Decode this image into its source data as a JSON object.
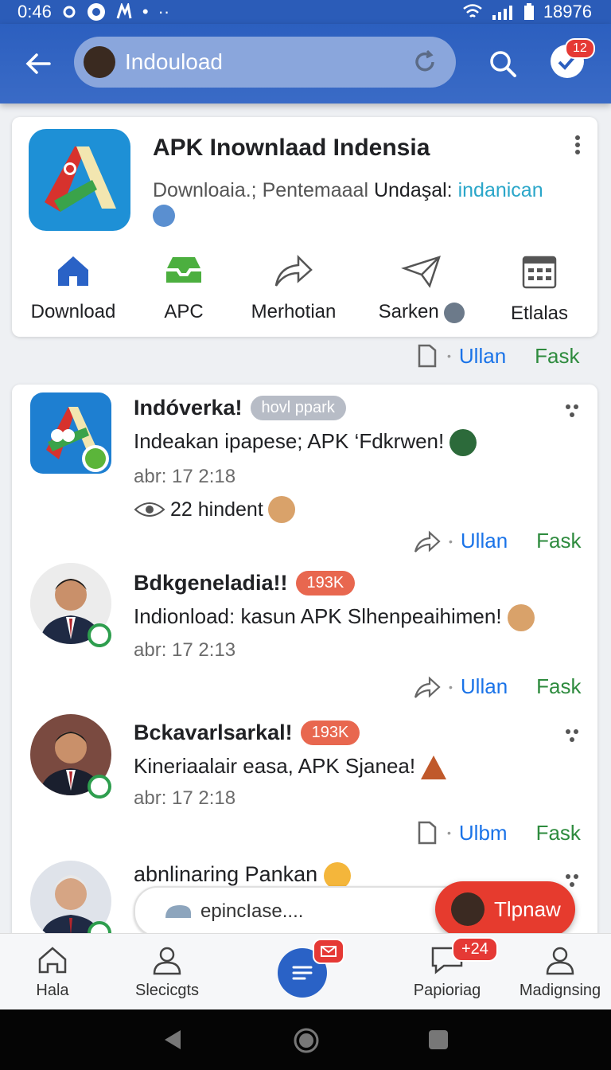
{
  "status_bar": {
    "time": "0:46",
    "battery_text": "18976"
  },
  "app_bar": {
    "search_value": "Indouload",
    "notification_count": "12"
  },
  "app_card": {
    "title": "APK Inownlaad Indensia",
    "subtitle_main": "Downloaia.; Pentemaaal",
    "subtitle_bold": "Undaşal:",
    "subtitle_link": "indanican",
    "actions": [
      {
        "label": "Download",
        "icon": "home-icon"
      },
      {
        "label": "APC",
        "icon": "inbox-icon"
      },
      {
        "label": "Merhotian",
        "icon": "share-arrow-icon"
      },
      {
        "label": "Sarken",
        "icon": "send-icon"
      },
      {
        "label": "Etlalas",
        "icon": "calendar-icon"
      }
    ]
  },
  "under_card_actions": {
    "primary": "Ullan",
    "secondary": "Fask"
  },
  "posts": [
    {
      "author": "Indóverka!",
      "badge": "hovl ppark",
      "badge_color": "#b7bcc6",
      "text": "Indeakan ipapese; APK ‘Fdkrwen!",
      "time": "abr: 17 2:18",
      "reach": "22 hindent",
      "action_primary": "Ullan",
      "action_secondary": "Fask"
    },
    {
      "author": "Bdkgeneladia!!",
      "badge": "193K",
      "badge_color": "#e8674f",
      "text": "Indionload: kasun APK Slhenpeaihimen!",
      "time": "abr: 17 2:13",
      "action_primary": "Ullan",
      "action_secondary": "Fask"
    },
    {
      "author": "Bckavarlsarkal!",
      "badge": "193K",
      "badge_color": "#e8674f",
      "text": "Kineriaalair easa, APK Sjanea!",
      "time": "abr: 17 2:18",
      "action_primary": "Ulbm",
      "action_secondary": "Fask"
    },
    {
      "author": "abnlinaring Pankan"
    }
  ],
  "composer": {
    "placeholder": "epincIase...."
  },
  "fab": {
    "label": "Tlpnaw"
  },
  "bottom_nav": [
    {
      "label": "Hala",
      "icon": "home-outline-icon"
    },
    {
      "label": "Slecicgts",
      "icon": "profile-icon"
    },
    {
      "label": "",
      "icon": "menu-icon",
      "badge": ""
    },
    {
      "label": "Papioriag",
      "icon": "chat-icon",
      "badge": "+24"
    },
    {
      "label": "Madignsing",
      "icon": "profile-icon"
    }
  ],
  "colors": {
    "app_bar": "#2c5fbf",
    "link": "#1a73e8",
    "green": "#2e8b3e",
    "badge": "#e53935"
  }
}
